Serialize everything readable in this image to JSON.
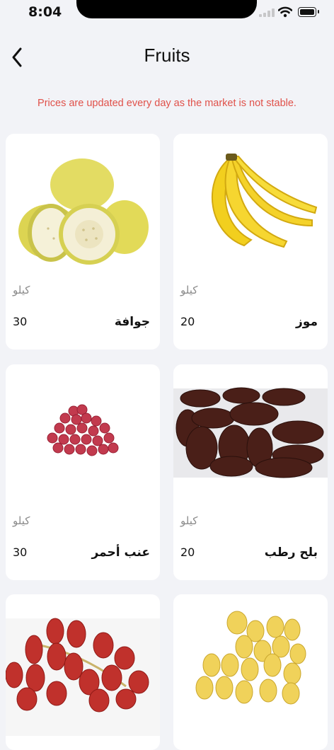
{
  "status": {
    "time": "8:04"
  },
  "header": {
    "title": "Fruits"
  },
  "notice": "Prices are updated every day as the market is not stable.",
  "products": [
    {
      "name": "جوافة",
      "unit": "كيلو",
      "price": "30"
    },
    {
      "name": "موز",
      "unit": "كيلو",
      "price": "20"
    },
    {
      "name": "عنب أحمر",
      "unit": "كيلو",
      "price": "30"
    },
    {
      "name": "بلح رطب",
      "unit": "كيلو",
      "price": "20"
    }
  ]
}
